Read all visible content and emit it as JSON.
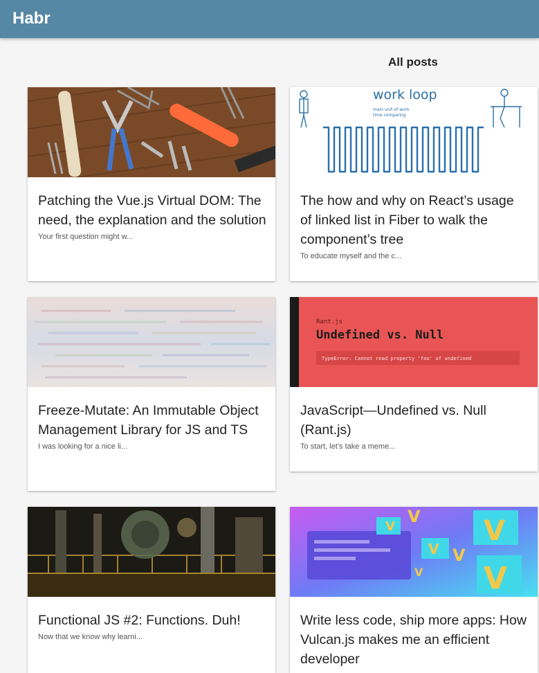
{
  "app": {
    "title": "Habr"
  },
  "section": {
    "title": "All posts"
  },
  "posts": [
    {
      "title": "Patching the Vue.js Virtual DOM: The need, the explanation and the solution",
      "excerpt": "Your first question might w...",
      "thumb": "tools-on-wood-image"
    },
    {
      "title": "The how and why on React’s usage of linked list in Fiber to walk the component’s tree",
      "excerpt": "To educate myself and the c...",
      "thumb": "work-loop-sketch-image",
      "thumb_text": {
        "heading": "work  loop",
        "line1": "main unit of work",
        "line2": "time comparing"
      }
    },
    {
      "title": "Freeze-Mutate: An Immutable Object Management Library for JS and TS",
      "excerpt": "I was looking for a nice li...",
      "thumb": "blurred-code-image"
    },
    {
      "title": "JavaScript—Undefined vs. Null (Rant.js)",
      "excerpt": "To start, let’s take a meme...",
      "thumb": "undefined-vs-null-banner",
      "thumb_text": {
        "small": "Rant.js",
        "heading": "Undefined vs. Null",
        "error": "TypeError: Cannot read property 'foo' of undefined"
      }
    },
    {
      "title": "Functional JS #2: Functions. Duh!",
      "excerpt": "Now that we know why learni...",
      "thumb": "industrial-machinery-image"
    },
    {
      "title": "Write less code, ship more apps: How Vulcan.js makes me an efficient developer",
      "excerpt": "",
      "thumb": "vulcan-gradient-image",
      "thumb_text": {
        "letter": "V"
      }
    }
  ],
  "colors": {
    "appbar": "#5688a6",
    "undefined_banner": "#e95555",
    "work_loop_blue": "#2a6fa8"
  }
}
